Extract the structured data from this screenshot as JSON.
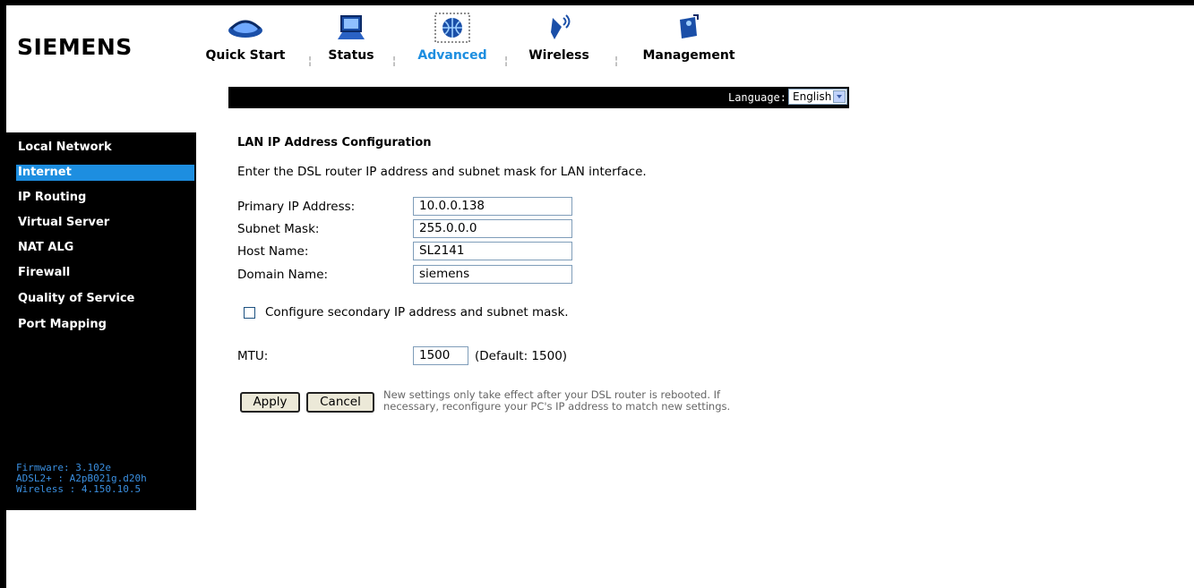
{
  "brand": "SIEMENS",
  "nav": [
    {
      "label": "Quick Start",
      "icon": "quick-start-icon",
      "active": false
    },
    {
      "label": "Status",
      "icon": "status-monitor-icon",
      "active": false
    },
    {
      "label": "Advanced",
      "icon": "advanced-globe-icon",
      "active": true
    },
    {
      "label": "Wireless",
      "icon": "wireless-icon",
      "active": false
    },
    {
      "label": "Management",
      "icon": "management-icon",
      "active": false
    }
  ],
  "language": {
    "label": "Language:",
    "value": "English"
  },
  "sidebar": {
    "items": [
      {
        "label": "Local Network",
        "active": false
      },
      {
        "label": "Internet",
        "active": true
      },
      {
        "label": "IP Routing",
        "active": false
      },
      {
        "label": "Virtual Server",
        "active": false
      },
      {
        "label": "NAT ALG",
        "active": false
      },
      {
        "label": "Firewall",
        "active": false
      },
      {
        "label": "Quality of Service",
        "active": false
      },
      {
        "label": "Port Mapping",
        "active": false
      }
    ],
    "firmware": [
      "Firmware: 3.102e",
      "ADSL2+ : A2pB021g.d20h",
      "Wireless : 4.150.10.5"
    ]
  },
  "form": {
    "title": "LAN IP Address Configuration",
    "description": "Enter the DSL router IP address and subnet mask for LAN interface.",
    "fields": [
      {
        "label": "Primary IP Address:",
        "value": "10.0.0.138"
      },
      {
        "label": "Subnet Mask:",
        "value": "255.0.0.0"
      },
      {
        "label": "Host Name:",
        "value": "SL2141"
      },
      {
        "label": "Domain Name:",
        "value": "siemens"
      }
    ],
    "secondary_checkbox_label": "Configure secondary IP address and subnet mask.",
    "secondary_checked": false,
    "mtu": {
      "label": "MTU:",
      "value": "1500",
      "default": "(Default: 1500)"
    },
    "apply_label": "Apply",
    "cancel_label": "Cancel",
    "note_line1": "New settings only take effect after your DSL router is rebooted. If",
    "note_line2": "necessary, reconfigure your PC's IP address to match new settings."
  },
  "colors": {
    "accent": "#1d8ee0",
    "sidebar_bg": "#000000",
    "firmware_text": "#3a8fe0"
  }
}
